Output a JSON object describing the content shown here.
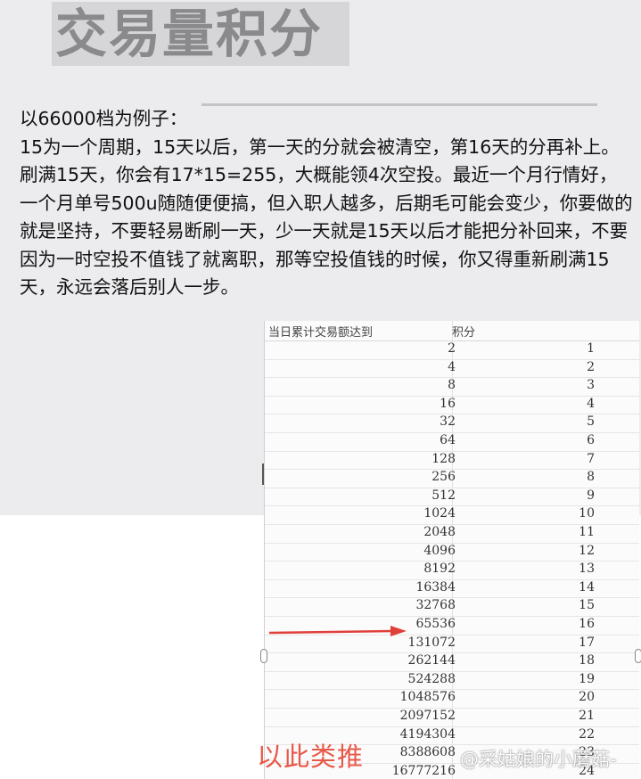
{
  "slide": {
    "title": "交易量积分",
    "paragraph": "以66000档为例子：\n15为一个周期，15天以后，第一天的分就会被清空，第16天的分再补上。\n刷满15天，你会有17*15=255，大概能领4次空投。最近一个月行情好，一个月单号500u随随便便搞，但入职人越多，后期毛可能会变少，你要做的就是坚持，不要轻易断刷一天，少一天就是15天以后才能把分补回来，不要因为一时空投不值钱了就离职，那等空投值钱的时候，你又得重新刷满15天，永远会落后别人一步。"
  },
  "table": {
    "header_amount": "当日累计交易额达到",
    "header_points": "积分",
    "rows": [
      {
        "amount": "2",
        "points": "1"
      },
      {
        "amount": "4",
        "points": "2"
      },
      {
        "amount": "8",
        "points": "3"
      },
      {
        "amount": "16",
        "points": "4"
      },
      {
        "amount": "32",
        "points": "5"
      },
      {
        "amount": "64",
        "points": "6"
      },
      {
        "amount": "128",
        "points": "7"
      },
      {
        "amount": "256",
        "points": "8"
      },
      {
        "amount": "512",
        "points": "9"
      },
      {
        "amount": "1024",
        "points": "10"
      },
      {
        "amount": "2048",
        "points": "11"
      },
      {
        "amount": "4096",
        "points": "12"
      },
      {
        "amount": "8192",
        "points": "13"
      },
      {
        "amount": "16384",
        "points": "14"
      },
      {
        "amount": "32768",
        "points": "15"
      },
      {
        "amount": "65536",
        "points": "16"
      },
      {
        "amount": "131072",
        "points": "17"
      },
      {
        "amount": "262144",
        "points": "18"
      },
      {
        "amount": "524288",
        "points": "19"
      },
      {
        "amount": "1048576",
        "points": "20"
      },
      {
        "amount": "2097152",
        "points": "21"
      },
      {
        "amount": "4194304",
        "points": "22"
      },
      {
        "amount": "8388608",
        "points": "23"
      },
      {
        "amount": "16777216",
        "points": "24"
      }
    ],
    "highlighted_amount": "65536"
  },
  "annotation": "以此类推",
  "watermark": "@采姑娘的小蘑菇-",
  "colors": {
    "annotation_red": "#e8584a",
    "arrow_red": "#e0403a"
  }
}
